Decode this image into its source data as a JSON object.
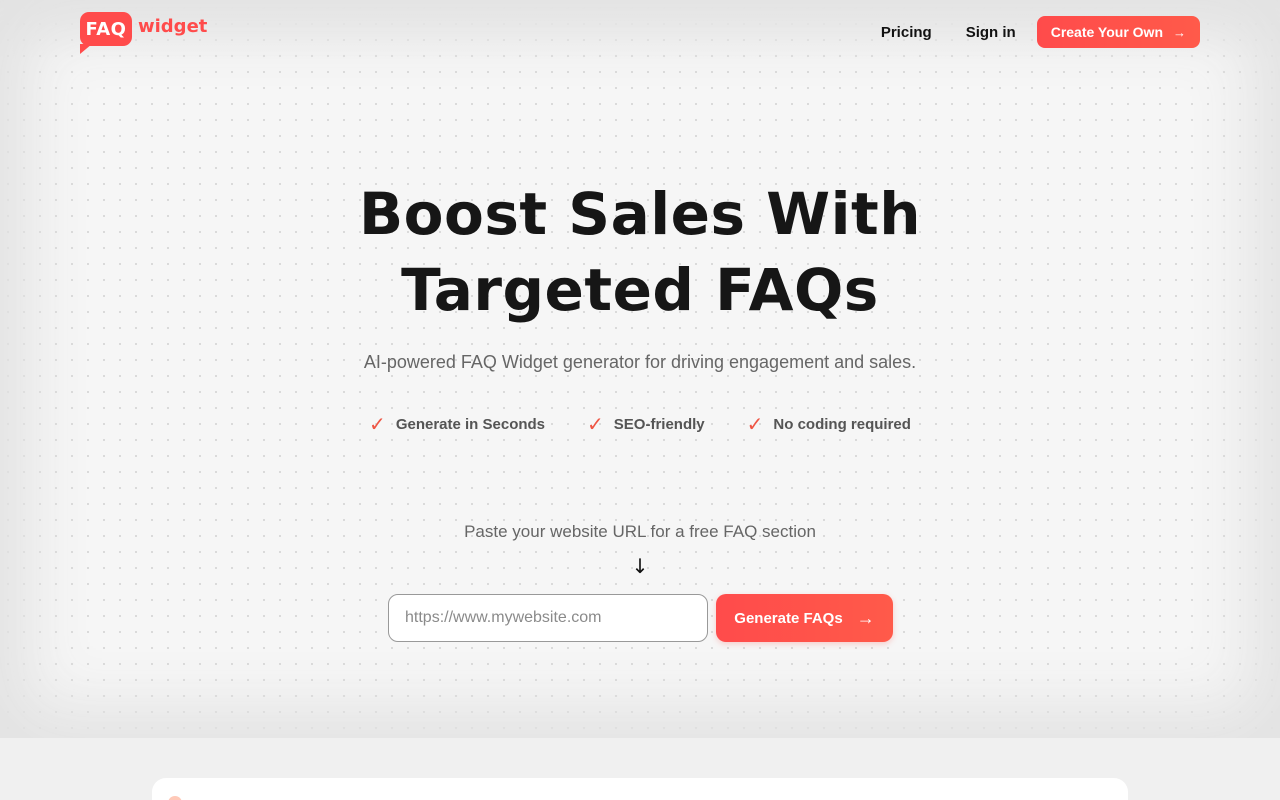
{
  "header": {
    "logo_badge": "FAQ",
    "logo_word": "widget",
    "nav": {
      "pricing": "Pricing",
      "sign_in": "Sign in",
      "cta": "Create Your Own",
      "cta_icon": "arrow-right-icon"
    }
  },
  "hero": {
    "headline_line1": "Boost Sales With",
    "headline_line2": "Targeted FAQs",
    "subtitle": "AI-powered FAQ Widget generator for driving engagement and sales.",
    "features": [
      {
        "label": "Generate in Seconds",
        "icon": "check-icon"
      },
      {
        "label": "SEO-friendly",
        "icon": "check-icon"
      },
      {
        "label": "No coding required",
        "icon": "check-icon"
      }
    ],
    "prompt": "Paste your website URL for a free FAQ section",
    "down_icon": "arrow-down-icon",
    "url_input": {
      "value": "",
      "placeholder": "https://www.mywebsite.com"
    },
    "generate_button": "Generate FAQs"
  },
  "colors": {
    "accent": "#ff4b4b",
    "background": "#f6f6f6",
    "text": "#161616"
  }
}
